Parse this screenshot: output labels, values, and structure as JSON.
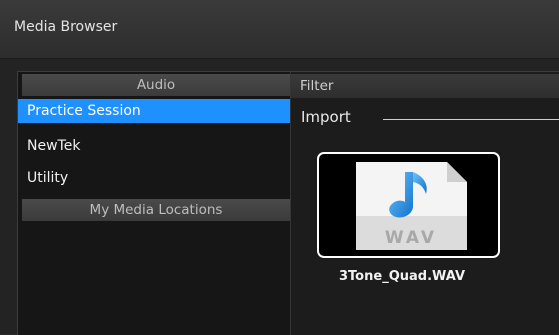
{
  "window": {
    "title": "Media Browser"
  },
  "sidebar": {
    "audio_header": "Audio",
    "items": [
      {
        "label": "Practice Session",
        "selected": true
      },
      {
        "label": "NewTek",
        "selected": false
      },
      {
        "label": "Utility",
        "selected": false
      }
    ],
    "locations_header": "My Media Locations"
  },
  "main": {
    "filter_label": "Filter",
    "import_label": "Import",
    "files": [
      {
        "name": "3Tone_Quad.WAV",
        "icon": "wav-file-icon",
        "icon_text": "WAV"
      }
    ]
  },
  "colors": {
    "selection": "#1e90ff",
    "note": "#2a8fe0"
  }
}
